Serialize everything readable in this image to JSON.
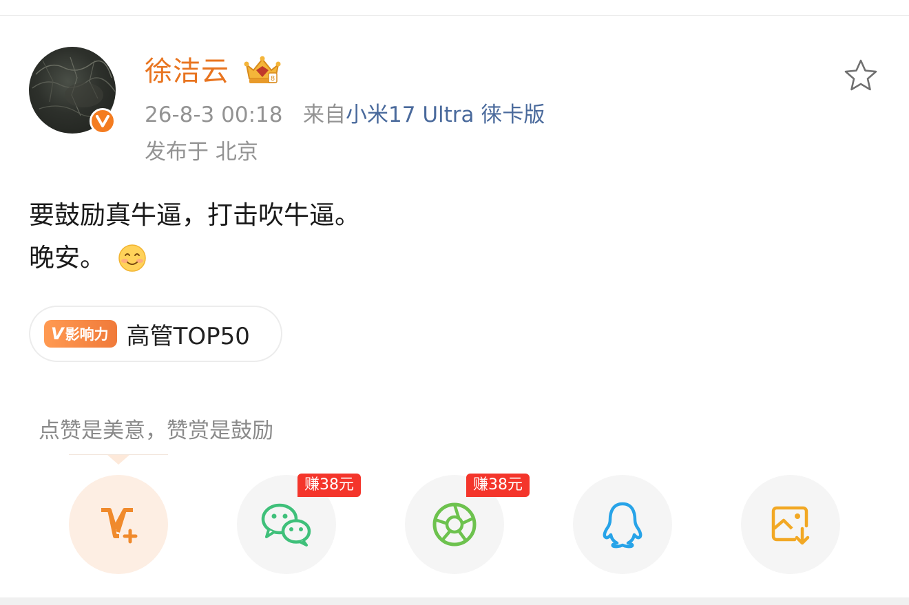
{
  "post": {
    "author": {
      "name": "徐洁云",
      "verified_badge": "V",
      "crown_icon": "vip-crown-icon"
    },
    "meta": {
      "timestamp": "26-8-3 00:18",
      "source_prefix": "来自",
      "device": "小米17 Ultra 徕卡版",
      "location": "发布于 北京"
    },
    "content": {
      "line1": "要鼓励真牛逼，打击吹牛逼。",
      "line2": "晚安。",
      "emoji": "smile-emoji"
    },
    "influence": {
      "badge_v": "V",
      "badge_label": "影响力",
      "text": "高管TOP50"
    }
  },
  "reward": {
    "hint": "点赞是美意，赞赏是鼓励"
  },
  "share": {
    "items": [
      {
        "name": "v-reward",
        "icon": "v-plus-icon"
      },
      {
        "name": "wechat",
        "icon": "wechat-icon",
        "tag": "赚38元"
      },
      {
        "name": "moments",
        "icon": "moments-icon",
        "tag": "赚38元"
      },
      {
        "name": "qq",
        "icon": "qq-icon"
      },
      {
        "name": "save-image",
        "icon": "save-image-icon"
      }
    ]
  },
  "colors": {
    "author_name": "#e8741f",
    "device_link": "#4a6a9c",
    "earn_tag": "#f4352b",
    "wechat": "#3fc07a",
    "moments": "#6dc24e",
    "qq": "#27a3e8",
    "save": "#f2a824"
  }
}
